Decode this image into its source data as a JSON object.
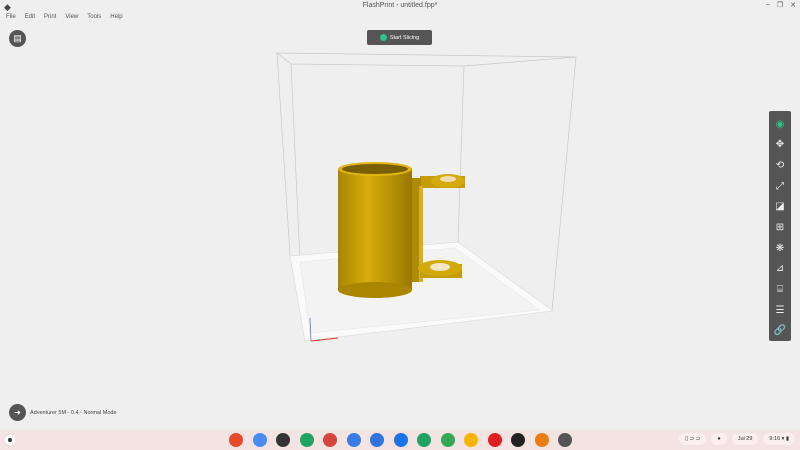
{
  "window": {
    "title": "FlashPrint - untitled.fpp*",
    "minimize": "–",
    "maximize": "❐",
    "close": "✕"
  },
  "menu": [
    "File",
    "Edit",
    "Print",
    "View",
    "Tools",
    "Help"
  ],
  "slice_button": "Start Slicing",
  "toolbar": [
    {
      "name": "view-icon",
      "glyph": "◉"
    },
    {
      "name": "move-icon",
      "glyph": "✥"
    },
    {
      "name": "rotate-icon",
      "glyph": "⟲"
    },
    {
      "name": "scale-icon",
      "glyph": "⤢"
    },
    {
      "name": "cut-icon",
      "glyph": "◪"
    },
    {
      "name": "add-icon",
      "glyph": "⊞"
    },
    {
      "name": "supports-icon",
      "glyph": "❋"
    },
    {
      "name": "surface-icon",
      "glyph": "⊿"
    },
    {
      "name": "cylinder-icon",
      "glyph": "⌸"
    },
    {
      "name": "settings-sliders-icon",
      "glyph": "☰"
    },
    {
      "name": "link-icon",
      "glyph": "🔗"
    }
  ],
  "status": {
    "printer": "Adventurer 5M - 0.4 - Normal Mode"
  },
  "shelf": {
    "apps": [
      {
        "name": "chrome",
        "color": "#e7492f"
      },
      {
        "name": "gemini",
        "color": "#4a8af4"
      },
      {
        "name": "app3",
        "color": "#333"
      },
      {
        "name": "app4",
        "color": "#1ea362"
      },
      {
        "name": "gmail",
        "color": "#d44638"
      },
      {
        "name": "calendar",
        "color": "#3b7be8"
      },
      {
        "name": "files",
        "color": "#2f74e0"
      },
      {
        "name": "chat",
        "color": "#1d73e8"
      },
      {
        "name": "meet",
        "color": "#21a366"
      },
      {
        "name": "play",
        "color": "#34a853"
      },
      {
        "name": "photos",
        "color": "#f4b400"
      },
      {
        "name": "youtube",
        "color": "#e02020"
      },
      {
        "name": "flashprint",
        "color": "#222"
      },
      {
        "name": "blender",
        "color": "#e87d0d"
      },
      {
        "name": "app15",
        "color": "#555"
      }
    ],
    "date": "Jul 29",
    "time": "9:16"
  },
  "colors": {
    "accent": "#2bc48a",
    "model": "#d4aa0a"
  }
}
